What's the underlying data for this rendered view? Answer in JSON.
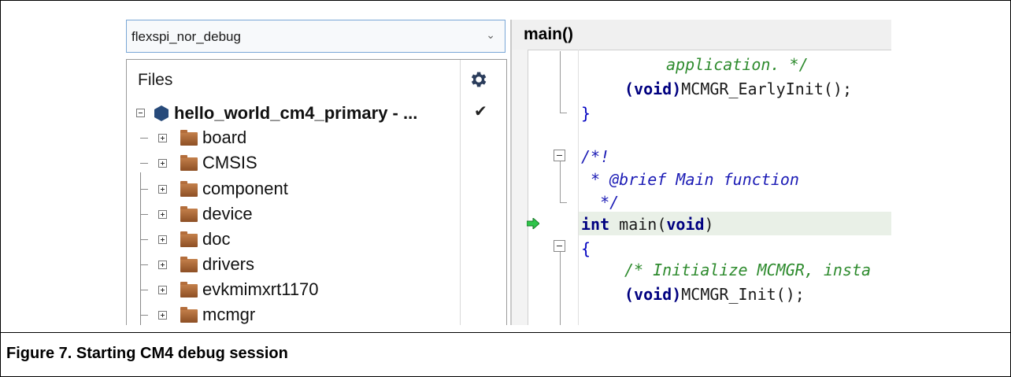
{
  "workspace": {
    "configuration": "flexspi_nor_debug",
    "files_header": "Files",
    "project": "hello_world_cm4_primary - ...",
    "folders": [
      "board",
      "CMSIS",
      "component",
      "device",
      "doc",
      "drivers",
      "evkmimxrt1170",
      "mcmgr"
    ]
  },
  "editor": {
    "function_label": "main()",
    "lines": {
      "l1": "application. */",
      "l2_kw": "(void)",
      "l2_rest": "MCMGR_EarlyInit();",
      "l3": "}",
      "l4": "/*!",
      "l5_a": " * ",
      "l5_b": "@brief Main function",
      "l6": "  */",
      "l7_a": "int",
      "l7_b": " main(",
      "l7_c": "void",
      "l7_d": ")",
      "l8": "{",
      "l9": "/* Initialize MCMGR, insta",
      "l10_kw": "(void)",
      "l10_rest": "MCMGR_Init();"
    }
  },
  "caption": "Figure 7. Starting CM4 debug session",
  "colors": {
    "accent_arrow": "#2ec44a",
    "folder": "#a0602f",
    "keyword": "#0000c0",
    "comment": "#2e8b2e"
  }
}
